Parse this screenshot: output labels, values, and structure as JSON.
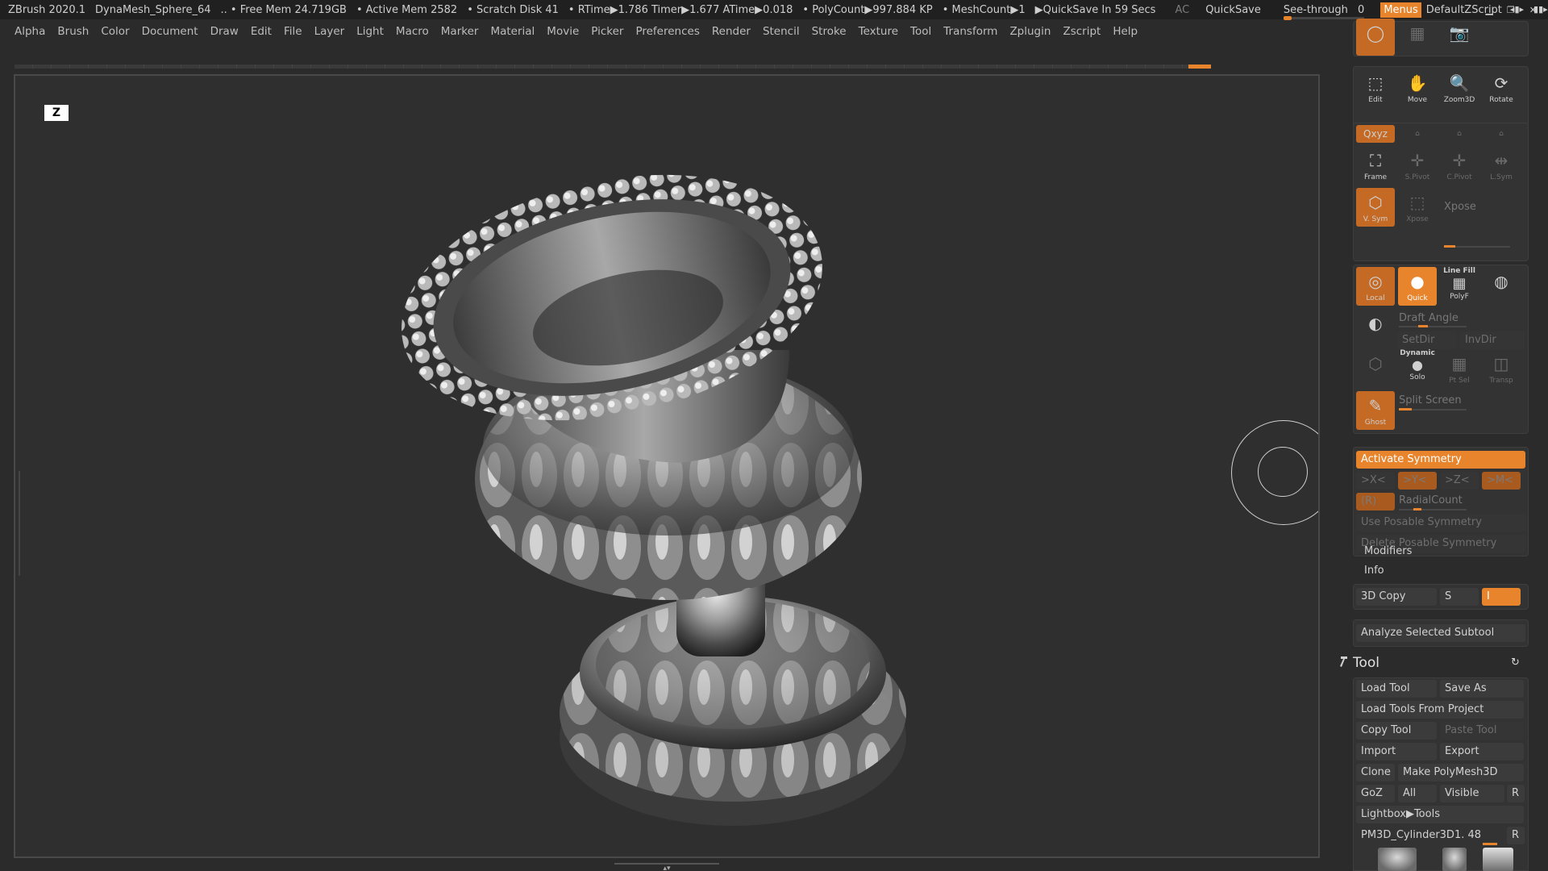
{
  "titlebar": {
    "app": "ZBrush 2020.1",
    "document": "DynaMesh_Sphere_64",
    "free_mem": ".. • Free Mem 24.719GB",
    "active_mem": "• Active Mem 2582",
    "scratch": "• Scratch Disk 41",
    "rtime": "• RTime▶1.786 Timer▶1.677 ATime▶0.018",
    "polycount": "• PolyCount▶997.884 KP",
    "meshcount": "• MeshCount▶1",
    "quicksave_timer": "▶QuickSave In 59 Secs",
    "ac": "AC",
    "quicksave": "QuickSave",
    "see_through_label": "See-through",
    "see_through_value": "0",
    "menus": "Menus",
    "script": "DefaultZScript"
  },
  "menubar": [
    "Alpha",
    "Brush",
    "Color",
    "Document",
    "Draw",
    "Edit",
    "File",
    "Layer",
    "Light",
    "Macro",
    "Marker",
    "Material",
    "Movie",
    "Picker",
    "Preferences",
    "Render",
    "Stencil",
    "Stroke",
    "Texture",
    "Tool",
    "Transform",
    "Zplugin",
    "Zscript",
    "Help"
  ],
  "canvas": {
    "badge": "Z",
    "model_description": "sculpted ornate urn"
  },
  "panel": {
    "nav": {
      "edit": "Edit",
      "move": "Move",
      "zoom": "Zoom3D",
      "rotate": "Rotate"
    },
    "xyz": "Qxyz",
    "frame": "Frame",
    "spivot": "S.Pivot",
    "cpivot": "C.Pivot",
    "lsym": "L.Sym",
    "vsym": "V. Sym",
    "xpose_btn": "Xpose",
    "xpose_label": "Xpose",
    "local": "Local",
    "quick": "Quick",
    "linefill_header": "Line Fill",
    "polyf": "PolyF",
    "draft_angle": "Draft Angle",
    "setdir": "SetDir",
    "invdir": "InvDir",
    "dynamic_header": "Dynamic",
    "solo": "Solo",
    "ptsel": "Pt Sel",
    "transp": "Transp",
    "ghost": "Ghost",
    "split_screen": "Split Screen",
    "activate_symmetry": "Activate Symmetry",
    "sym_x": ">X<",
    "sym_y": ">Y<",
    "sym_z": ">Z<",
    "sym_m": ">M<",
    "sym_r": "(R)",
    "radial_count": "RadialCount",
    "use_posable": "Use Posable Symmetry",
    "delete_posable": "Delete Posable Symmetry",
    "modifiers": "Modifiers",
    "info": "Info",
    "copy3d": "3D Copy",
    "copy3d_s": "S",
    "copy3d_i": "I",
    "analyze": "Analyze Selected Subtool",
    "tool_title": "Tool",
    "load_tool": "Load Tool",
    "save_as": "Save As",
    "load_from_project": "Load Tools From Project",
    "copy_tool": "Copy Tool",
    "paste_tool": "Paste Tool",
    "import": "Import",
    "export": "Export",
    "clone": "Clone",
    "make_polymesh": "Make PolyMesh3D",
    "goz": "GoZ",
    "all": "All",
    "visible": "Visible",
    "r": "R",
    "lightbox_tools": "Lightbox▶Tools",
    "current_tool": "PM3D_Cylinder3D1. 48",
    "r2": "R"
  },
  "colors": {
    "accent": "#e8842c",
    "bg": "#2b2b2b",
    "panel": "#333333"
  }
}
